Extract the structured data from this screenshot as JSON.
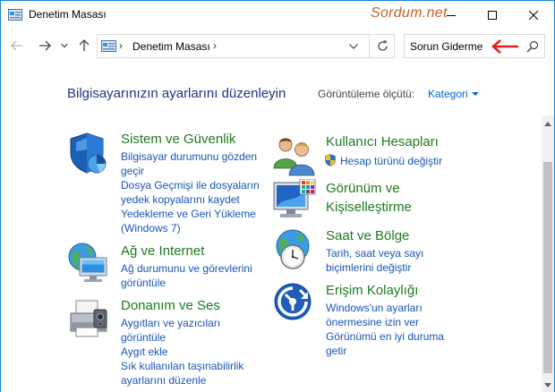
{
  "window": {
    "title": "Denetim Masası",
    "watermark": "Sordum.net"
  },
  "address": {
    "path": "Denetim Masası",
    "search_value": "Sorun Giderme"
  },
  "header": {
    "heading": "Bilgisayarınızın ayarlarını düzenleyin",
    "viewby_label": "Görüntüleme ölçütü:",
    "viewby_value": "Kategori"
  },
  "categories": {
    "security": {
      "title": "Sistem ve Güvenlik",
      "links": [
        "Bilgisayar durumunu gözden",
        "geçir",
        "Dosya Geçmişi ile dosyaların",
        "yedek kopyalarını kaydet",
        "Yedekleme ve Geri Yükleme",
        "(Windows 7)"
      ]
    },
    "network": {
      "title": "Ağ ve Internet",
      "links": [
        "Ağ durumunu ve görevlerini",
        "görüntüle"
      ]
    },
    "hardware": {
      "title": "Donanım ve Ses",
      "links": [
        "Aygıtları ve yazıcıları",
        "görüntüle",
        "Aygıt ekle",
        "Sık kullanılan taşınabilirlik",
        "ayarlarını düzenle"
      ]
    },
    "users": {
      "title": "Kullanıcı Hesapları",
      "links": [
        "Hesap türünü değiştir"
      ]
    },
    "appearance": {
      "title_line1": "Görünüm ve",
      "title_line2": "Kişiselleştirme"
    },
    "clock": {
      "title": "Saat ve Bölge",
      "links": [
        "Tarih, saat veya sayı",
        "biçimlerini değiştir"
      ]
    },
    "ease": {
      "title": "Erişim Kolaylığı",
      "links": [
        "Windows'un ayarları",
        "önermesine izin ver",
        "Görünümü en iyi duruma",
        "getir"
      ]
    }
  },
  "colors": {
    "accent_link": "#1a55b5",
    "category_title": "#1f7a1f",
    "heading": "#1e3287",
    "watermark": "#c8622a",
    "annotation_arrow": "#e0201c"
  },
  "icons": {
    "title": "control-panel-icon",
    "security": "shield-icon",
    "network": "network-globe-icon",
    "hardware": "printer-icon",
    "users": "users-icon",
    "appearance": "monitor-icon",
    "clock": "clock-globe-icon",
    "ease": "ease-of-access-icon"
  }
}
